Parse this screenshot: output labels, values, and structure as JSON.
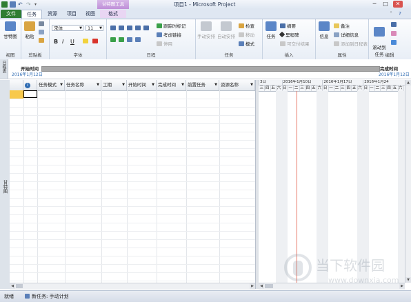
{
  "window": {
    "title": "项目1 - Microsoft Project",
    "context_group": "甘特图工具",
    "controls": {
      "minimize": "─",
      "restore": "□",
      "close": "✕"
    }
  },
  "tabs": {
    "file": "文件",
    "task": "任务",
    "resource": "资源",
    "project": "项目",
    "view": "视图",
    "format": "格式"
  },
  "ribbon": {
    "view_group": {
      "gantt_label": "甘特图",
      "group_label": "视图"
    },
    "clipboard": {
      "paste_label": "粘贴",
      "group_label": "剪贴板"
    },
    "font": {
      "font_name": "宋体",
      "font_size": "11",
      "bold": "B",
      "italic": "I",
      "underline": "U",
      "group_label": "字体"
    },
    "schedule": {
      "mark_on_track": "跟踪时标记",
      "respect_links": "考虑链接",
      "inactivate": "停用",
      "group_label": "日程"
    },
    "tasks": {
      "manual_schedule": "手动安排",
      "auto_schedule": "自动安排",
      "inspect": "检查",
      "move": "移动",
      "mode": "模式",
      "group_label": "任务"
    },
    "insert": {
      "task": "任务",
      "summary": "摘要",
      "milestone": "里程碑",
      "deliverable": "可交付结果",
      "group_label": "插入"
    },
    "properties": {
      "info": "信息",
      "notes": "备注",
      "details": "详细信息",
      "add_to_timeline": "添加到日程表",
      "group_label": "属性"
    },
    "editing": {
      "scroll_to_task": "滚动到\n任务",
      "group_label": "编辑"
    }
  },
  "timeline": {
    "side_label": "日程表",
    "start_label": "开始时间",
    "start_date": "2016年1月12日",
    "end_label": "完成时间",
    "end_date": "2016年1月12日"
  },
  "grid": {
    "side_label": "甘特图",
    "columns": [
      "任务模式",
      "任务名称",
      "工期",
      "开始时间",
      "完成时间",
      "前置任务",
      "资源名称"
    ]
  },
  "chart": {
    "week_labels": [
      "3日",
      "2016年1月10日",
      "2016年1月17日",
      "2016年1月24"
    ],
    "day_labels": [
      "三",
      "四",
      "五",
      "六",
      "日",
      "一",
      "二",
      "三",
      "四",
      "五",
      "六",
      "日",
      "一",
      "二",
      "三",
      "四",
      "五",
      "六",
      "日",
      "一",
      "二",
      "三",
      "四",
      "五",
      "六"
    ]
  },
  "status": {
    "ready": "就绪",
    "new_task": "新任务: 手动计划"
  },
  "watermark": {
    "cn": "当下软件园",
    "url": "www.downxia.com"
  }
}
